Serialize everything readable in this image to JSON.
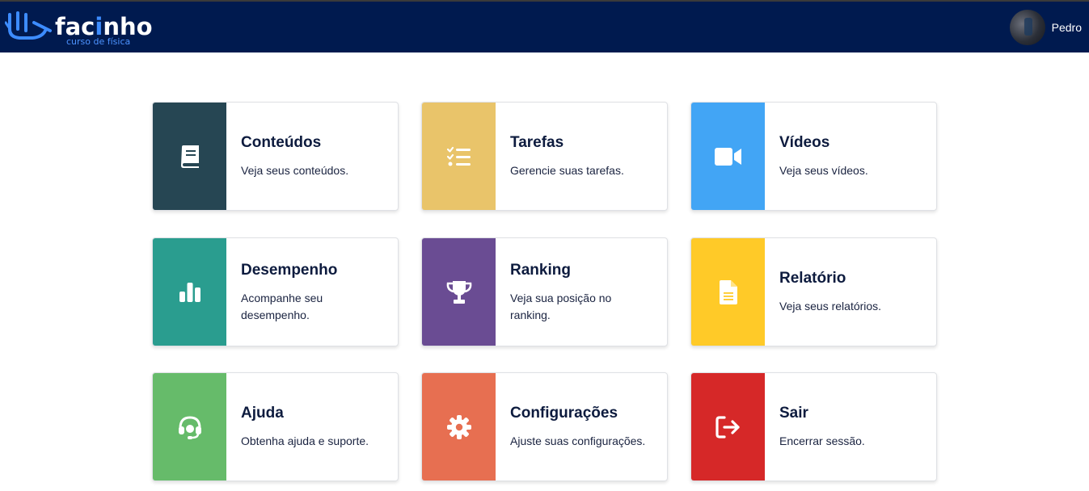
{
  "header": {
    "logo_text_pre": "fac",
    "logo_text_i": "i",
    "logo_text_post": "nho",
    "logo_subtitle": "curso de física",
    "user_name": "Pedro"
  },
  "cards": [
    {
      "title": "Conteúdos",
      "description": "Veja seus conteúdos.",
      "color": "#264653",
      "icon": "book-icon"
    },
    {
      "title": "Tarefas",
      "description": "Gerencie suas tarefas.",
      "color": "#e9c46a",
      "icon": "checklist-icon"
    },
    {
      "title": "Vídeos",
      "description": "Veja seus vídeos.",
      "color": "#42a5f5",
      "icon": "video-camera-icon"
    },
    {
      "title": "Desempenho",
      "description": "Acompanhe seu desempenho.",
      "color": "#2a9d8f",
      "icon": "bar-chart-icon"
    },
    {
      "title": "Ranking",
      "description": "Veja sua posição no ranking.",
      "color": "#6a4c93",
      "icon": "trophy-icon"
    },
    {
      "title": "Relatório",
      "description": "Veja seus relatórios.",
      "color": "#ffca28",
      "icon": "file-text-icon"
    },
    {
      "title": "Ajuda",
      "description": "Obtenha ajuda e suporte.",
      "color": "#66bb6a",
      "icon": "headset-icon"
    },
    {
      "title": "Configurações",
      "description": "Ajuste suas configurações.",
      "color": "#e76f51",
      "icon": "gear-icon"
    },
    {
      "title": "Sair",
      "description": "Encerrar sessão.",
      "color": "#d62828",
      "icon": "logout-icon"
    }
  ]
}
